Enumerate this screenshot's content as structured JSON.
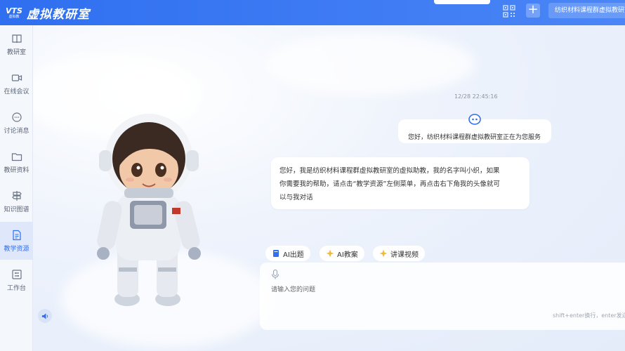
{
  "header": {
    "logo_big": "VTS",
    "logo_small": "虚拟教",
    "title": "虚拟教研室",
    "top_tab_text": "",
    "room_button": "纺织材料课程群虚拟教研室"
  },
  "sidebar": {
    "items": [
      {
        "label": "教研室",
        "icon": "book-icon"
      },
      {
        "label": "在线会议",
        "icon": "video-icon"
      },
      {
        "label": "讨论消息",
        "icon": "chat-icon"
      },
      {
        "label": "教研资料",
        "icon": "folder-icon"
      },
      {
        "label": "知识图谱",
        "icon": "signpost-icon"
      },
      {
        "label": "教学资源",
        "icon": "document-icon",
        "active": true
      },
      {
        "label": "工作台",
        "icon": "workbench-icon"
      }
    ]
  },
  "chat": {
    "timestamp": "12/28 22:45:16",
    "greeting": "您好，纺织材料课程群虚拟教研室正在为您服务",
    "intro_line1": "您好，我是纺织材料课程群虚拟教研室的虚拟助教，我的名字叫小织，如果",
    "intro_line2": "你需要我的帮助，请点击“教学资源”左侧菜单，再点击右下角我的头像就可",
    "intro_line3": "以与我对话"
  },
  "quick_actions": [
    {
      "label": "AI出题",
      "icon": "book-blue-icon"
    },
    {
      "label": "AI教案",
      "icon": "sparkle-icon"
    },
    {
      "label": "讲课视频",
      "icon": "sparkle-icon"
    }
  ],
  "input": {
    "placeholder": "请输入您的问题",
    "hint": "shift+enter换行，enter发送"
  },
  "colors": {
    "primary": "#2f6ff0",
    "accent_gold": "#f0b93a"
  }
}
